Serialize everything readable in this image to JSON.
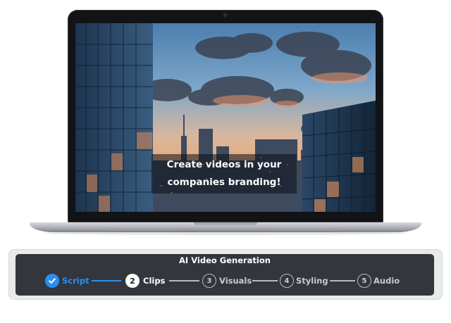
{
  "video_preview": {
    "caption_line1": "Create videos in your",
    "caption_line2": "companies branding!"
  },
  "generator": {
    "title": "AI Video Generation",
    "steps": [
      {
        "number": "",
        "label": "Script",
        "state": "completed"
      },
      {
        "number": "2",
        "label": "Clips",
        "state": "active"
      },
      {
        "number": "3",
        "label": "Visuals",
        "state": "pending"
      },
      {
        "number": "4",
        "label": "Styling",
        "state": "pending"
      },
      {
        "number": "5",
        "label": "Audio",
        "state": "pending"
      }
    ]
  },
  "colors": {
    "accent": "#2a8ff0",
    "panel": "#33363d",
    "panel_frame": "#e7ebea"
  }
}
